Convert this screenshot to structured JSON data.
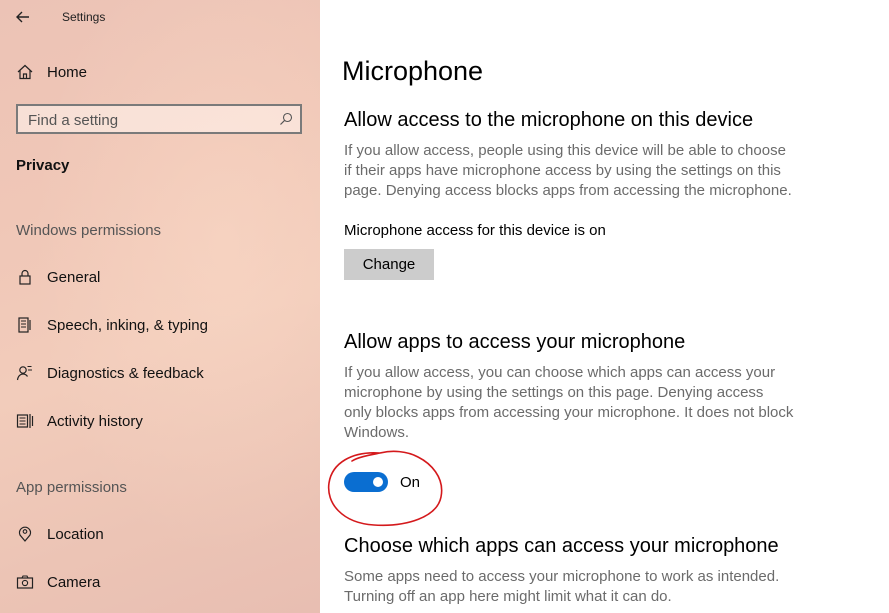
{
  "window": {
    "title": "Settings"
  },
  "sidebar": {
    "home_label": "Home",
    "search_placeholder": "Find a setting",
    "current_section": "Privacy",
    "groups": [
      {
        "header": "Windows permissions",
        "items": [
          {
            "label": "General",
            "icon": "lock-icon"
          },
          {
            "label": "Speech, inking, & typing",
            "icon": "speech-icon"
          },
          {
            "label": "Diagnostics & feedback",
            "icon": "diagnostics-icon"
          },
          {
            "label": "Activity history",
            "icon": "activity-history-icon"
          }
        ]
      },
      {
        "header": "App permissions",
        "items": [
          {
            "label": "Location",
            "icon": "location-icon"
          },
          {
            "label": "Camera",
            "icon": "camera-icon"
          }
        ]
      }
    ]
  },
  "main": {
    "title": "Microphone",
    "device_section": {
      "heading": "Allow access to the microphone on this device",
      "description": "If you allow access, people using this device will be able to choose if their apps have microphone access by using the settings on this page. Denying access blocks apps from accessing the microphone.",
      "status": "Microphone access for this device is on",
      "change_label": "Change"
    },
    "apps_section": {
      "heading": "Allow apps to access your microphone",
      "description": "If you allow access, you can choose which apps can access your microphone by using the settings on this page. Denying access only blocks apps from accessing your microphone. It does not block Windows.",
      "toggle_state": "On",
      "toggle_on": true
    },
    "choose_section": {
      "heading": "Choose which apps can access your microphone",
      "description": "Some apps need to access your microphone to work as intended. Turning off an app here might limit what it can do."
    }
  },
  "colors": {
    "accent": "#0a6ed1",
    "annotation": "#d4191c",
    "sidebar_bg": "#f0c7b7"
  }
}
